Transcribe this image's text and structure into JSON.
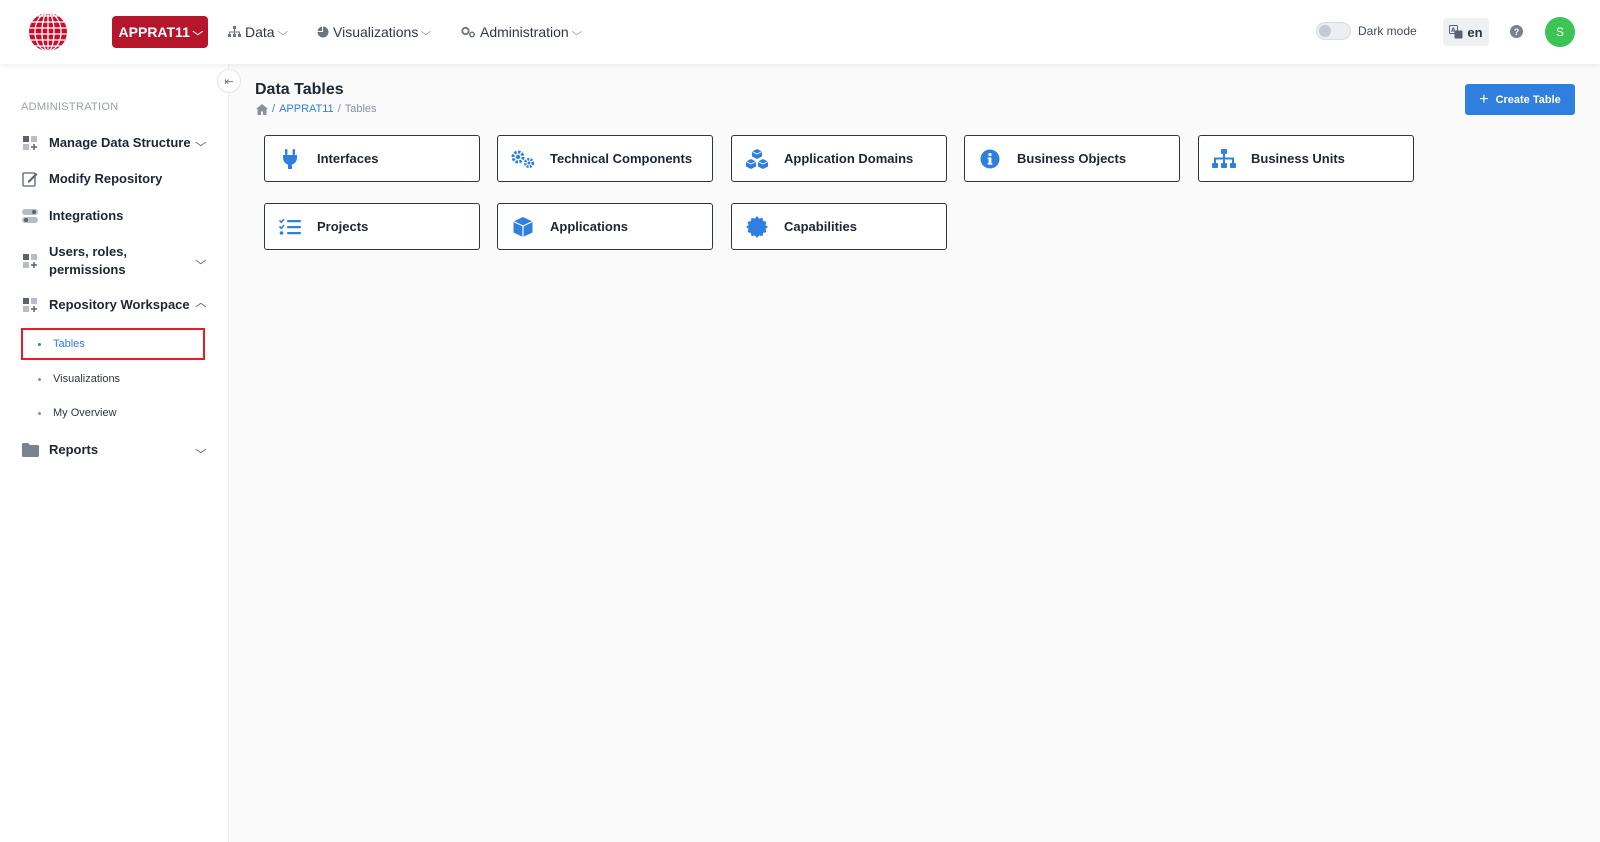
{
  "header": {
    "repo_label": "APPRAT11",
    "nav": [
      {
        "label": "Data",
        "icon": "sitemap-icon"
      },
      {
        "label": "Visualizations",
        "icon": "pie-chart-icon"
      },
      {
        "label": "Administration",
        "icon": "gears-icon"
      }
    ],
    "dark_mode_label": "Dark mode",
    "language": "en",
    "help_glyph": "?",
    "avatar_initial": "S"
  },
  "sidebar": {
    "heading": "ADMINISTRATION",
    "items": [
      {
        "label": "Manage Data Structure",
        "icon": "grid-plus-icon",
        "chevron": "down"
      },
      {
        "label": "Modify Repository",
        "icon": "edit-icon"
      },
      {
        "label": "Integrations",
        "icon": "toggles-icon"
      },
      {
        "label": "Users, roles, permissions",
        "icon": "grid-plus-icon",
        "chevron": "down"
      },
      {
        "label": "Repository Workspace",
        "icon": "grid-plus-icon",
        "chevron": "up"
      }
    ],
    "sub_items": [
      {
        "label": "Tables",
        "active": true
      },
      {
        "label": "Visualizations"
      },
      {
        "label": "My Overview"
      }
    ],
    "reports": {
      "label": "Reports",
      "icon": "folder-icon",
      "chevron": "down"
    }
  },
  "main": {
    "title": "Data Tables",
    "breadcrumb": {
      "repo": "APPRAT11",
      "current": "Tables"
    },
    "create_button": "Create Table",
    "tiles": [
      {
        "label": "Interfaces",
        "icon": "plug-icon"
      },
      {
        "label": "Technical Components",
        "icon": "gears-icon"
      },
      {
        "label": "Application Domains",
        "icon": "cubes-icon"
      },
      {
        "label": "Business Objects",
        "icon": "info-circle-icon"
      },
      {
        "label": "Business Units",
        "icon": "sitemap-icon"
      },
      {
        "label": "Projects",
        "icon": "tasks-icon"
      },
      {
        "label": "Applications",
        "icon": "cube-icon"
      },
      {
        "label": "Capabilities",
        "icon": "badge-icon"
      }
    ]
  },
  "colors": {
    "brand_red": "#b5162b",
    "accent_blue": "#2f7fe0",
    "avatar_green": "#3cc455",
    "highlight_red": "#e81d24"
  }
}
